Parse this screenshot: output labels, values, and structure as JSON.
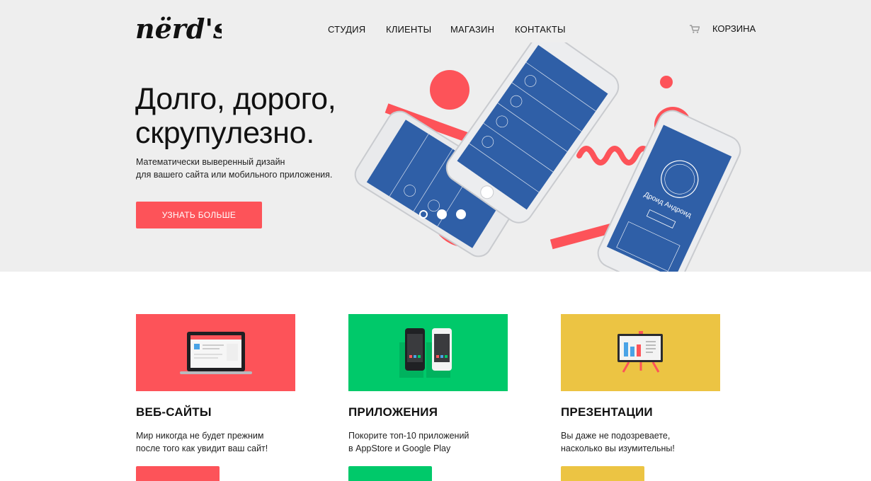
{
  "header": {
    "logo_text": "nërd's",
    "nav": [
      "СТУДИЯ",
      "КЛИЕНТЫ",
      "МАГАЗИН",
      "КОНТАКТЫ"
    ],
    "cart_label": "КОРЗИНА",
    "cart_icon": "cart-icon"
  },
  "hero": {
    "title": "Долго, дорого,\nскрупулезно.",
    "subtitle_lines": [
      "Математически выверенный дизайн",
      "для вашего сайта или мобильного приложения."
    ],
    "button_label": "УЗНАТЬ БОЛЬШЕ",
    "slides": 3,
    "active_slide": 1,
    "phone_labels": [
      "Дроид Андроид"
    ]
  },
  "services": [
    {
      "title": "ВЕБ-САЙТЫ",
      "text_lines": [
        "Мир никогда не будет прежним",
        "после того как увидит ваш сайт!"
      ],
      "color": "#fd5359",
      "icon": "laptop-icon"
    },
    {
      "title": "ПРИЛОЖЕНИЯ",
      "text_lines": [
        "Покорите топ-10 приложений",
        "в AppStore и Google Play"
      ],
      "color": "#00c96a",
      "icon": "smartphones-icon"
    },
    {
      "title": "ПРЕЗЕНТАЦИИ",
      "text_lines": [
        "Вы даже не подозреваете,",
        "насколько вы изумительны!"
      ],
      "color": "#ecc443",
      "icon": "presentation-board-icon"
    }
  ],
  "colors": {
    "accent": "#fd5359",
    "green": "#00c96a",
    "yellow": "#ecc443",
    "hero_bg": "#eeeeee",
    "phone_screen": "#2f5fa7"
  }
}
